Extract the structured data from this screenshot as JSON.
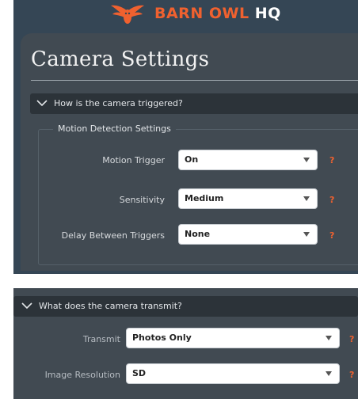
{
  "brand": {
    "name": "BARN OWL",
    "suffix": "HQ",
    "accent_color": "#f0612f",
    "logo_icon": "owl-wings-icon"
  },
  "page": {
    "title": "Camera Settings"
  },
  "trigger_section": {
    "heading": "How is the camera triggered?",
    "icon": "chevron-down-icon",
    "fieldset_legend": "Motion Detection Settings",
    "fields": [
      {
        "label": "Motion Trigger",
        "value": "On",
        "help": "?"
      },
      {
        "label": "Sensitivity",
        "value": "Medium",
        "help": "?"
      },
      {
        "label": "Delay Between Triggers",
        "value": "None",
        "help": "?"
      }
    ]
  },
  "transmit_section": {
    "heading": "What does the camera transmit?",
    "icon": "chevron-down-icon",
    "fields": [
      {
        "label": "Transmit",
        "value": "Photos Only",
        "help": "?"
      },
      {
        "label": "Image Resolution",
        "value": "SD",
        "help": "?"
      }
    ]
  }
}
